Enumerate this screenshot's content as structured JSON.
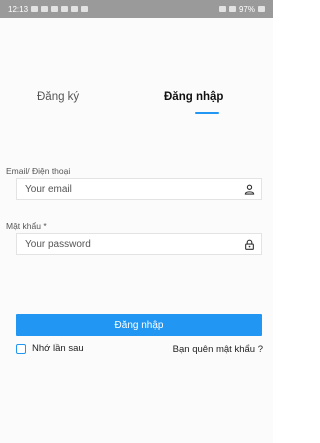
{
  "status_bar": {
    "time": "12:13",
    "battery": "97%"
  },
  "tabs": {
    "register": "Đăng ký",
    "login": "Đăng nhập"
  },
  "form": {
    "email_label": "Email/ Điện thoại",
    "email_placeholder": "Your email",
    "email_icon": "user-icon",
    "password_label": "Mật khẩu *",
    "password_placeholder": "Your password",
    "password_icon": "lock-icon",
    "submit_label": "Đăng nhập",
    "remember_label": "Nhớ lần sau",
    "forgot_label": "Bạn quên mật khẩu ?"
  },
  "colors": {
    "accent": "#2196f3",
    "status_bar": "#9a9a9a"
  }
}
